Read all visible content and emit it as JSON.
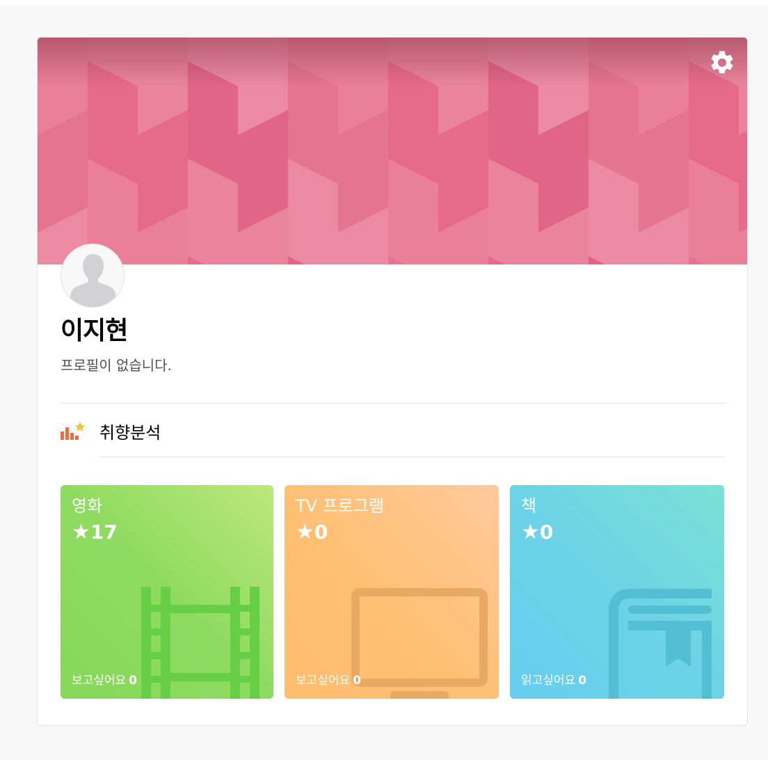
{
  "profile": {
    "name": "이지현",
    "bio": "프로필이 없습니다."
  },
  "icons": {
    "settings": "gear-icon",
    "avatar": "person-silhouette-icon",
    "analysis": "bar-chart-star-icon",
    "movie": "film-strip-icon",
    "tv": "tv-icon",
    "book": "book-icon"
  },
  "analysis": {
    "label": "취향분석"
  },
  "tiles": [
    {
      "title": "영화",
      "star": "★",
      "rating": "17",
      "wish_label": "보고싶어요",
      "wish_count": "0"
    },
    {
      "title": "TV 프로그램",
      "star": "★",
      "rating": "0",
      "wish_label": "보고싶어요",
      "wish_count": "0"
    },
    {
      "title": "책",
      "star": "★",
      "rating": "0",
      "wish_label": "읽고싶어요",
      "wish_count": "0"
    }
  ],
  "colors": {
    "cover": "#e8718f",
    "movie_tile": "#8edb61",
    "tv_tile": "#ffc073",
    "book_tile": "#6dd3e6",
    "analysis_accent": "#f4c542"
  }
}
